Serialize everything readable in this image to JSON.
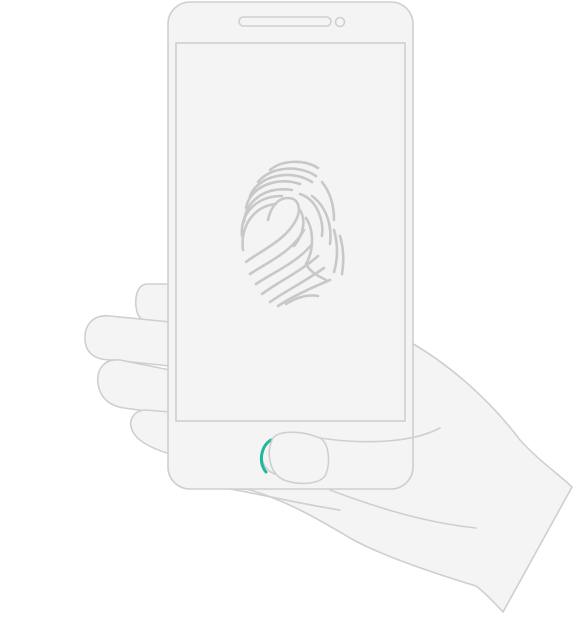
{
  "illustration": {
    "subject": "hand-holding-phone",
    "icon": "fingerprint-icon"
  },
  "colors": {
    "background": "#ffffff",
    "fill": "#f4f4f4",
    "stroke": "#cfcfcf",
    "fingerprint": "#c8c8c8",
    "accent": "#1fb89a"
  }
}
